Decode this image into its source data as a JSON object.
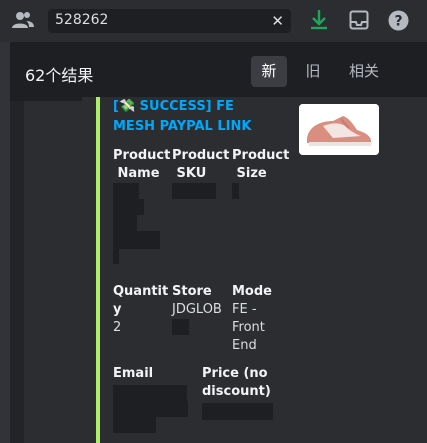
{
  "search": {
    "value": "528262"
  },
  "results": {
    "count_label": "62个结果",
    "sort_tabs": [
      {
        "label": "新",
        "active": true
      },
      {
        "label": "旧",
        "active": false
      },
      {
        "label": "相关",
        "active": false
      }
    ]
  },
  "embed": {
    "title_line1": "[💸 SUCCESS] FE",
    "title_line2": "MESH PAYPAL LINK",
    "accent_color": "#a8f06a",
    "fields": {
      "product_name": {
        "name_line1": "Product",
        "name_line2": " Name"
      },
      "product_sku": {
        "name_line1": "Product",
        "name_line2": " SKU"
      },
      "product_size": {
        "name_line1": "Product",
        "name_line2": " Size"
      },
      "quantity": {
        "name_line1": "Quantit",
        "name_line2": "y",
        "value": "2"
      },
      "store": {
        "name": "Store",
        "value": "JDGLOB"
      },
      "mode": {
        "name": "Mode",
        "value_line1": "FE -",
        "value_line2": "Front",
        "value_line3": "End"
      },
      "email": {
        "name": "Email"
      },
      "price": {
        "name_line1": "Price (no",
        "name_line2": "discount)"
      }
    }
  },
  "icons": {
    "members": "members-icon",
    "clear": "close-icon",
    "download": "download-icon",
    "inbox": "inbox-icon",
    "help": "help-icon",
    "money": "money-with-wings-icon"
  }
}
